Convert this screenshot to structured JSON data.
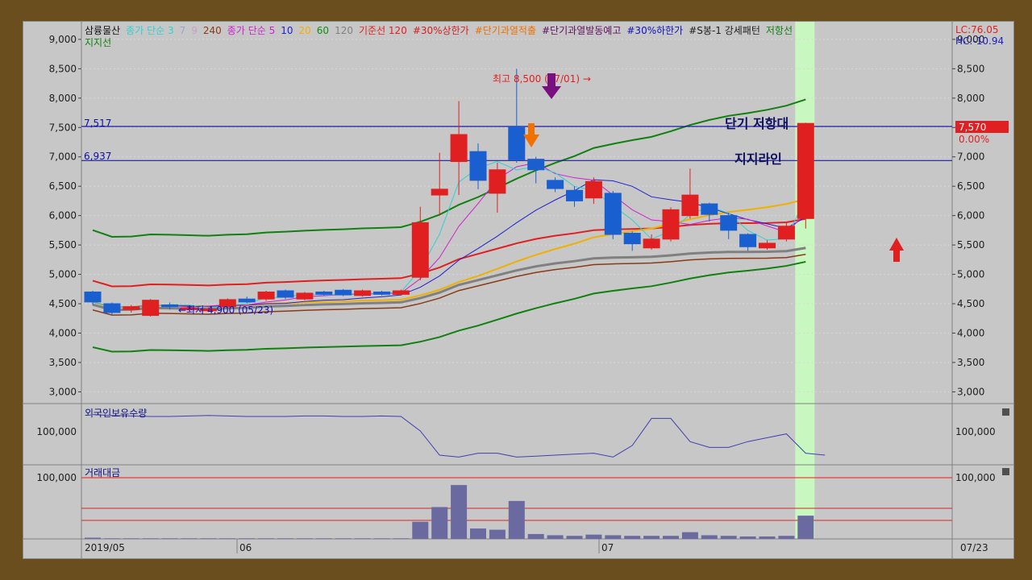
{
  "legend": [
    {
      "text": "삼륭물산",
      "color": "#111111"
    },
    {
      "text": "종가 단순 3",
      "color": "#31d0d0"
    },
    {
      "text": "7",
      "color": "#a0a0d8"
    },
    {
      "text": "9",
      "color": "#c8a0c8"
    },
    {
      "text": "240",
      "color": "#8a3a18"
    },
    {
      "text": "종가 단순 5",
      "color": "#d020d0"
    },
    {
      "text": "10",
      "color": "#2020d0"
    },
    {
      "text": "20",
      "color": "#f0b000"
    },
    {
      "text": "60",
      "color": "#109010"
    },
    {
      "text": "120",
      "color": "#808080"
    },
    {
      "text": "기준선 120",
      "color": "#e02020"
    },
    {
      "text": "#30%상한가",
      "color": "#d02020"
    },
    {
      "text": "#단기과열적출",
      "color": "#f07000"
    },
    {
      "text": "#단기과열발동예고",
      "color": "#601060"
    },
    {
      "text": "#30%하한가",
      "color": "#1010c0"
    },
    {
      "text": "#S봉-1 강세패턴",
      "color": "#202020"
    },
    {
      "text": "저항선",
      "color": "#108010"
    }
  ],
  "legend_line2": "지지선",
  "lc_label": "LC:76.05",
  "hc_label": "HC:-10.94",
  "price_label": "7,570",
  "pct_label": "0.00%",
  "resistance_label": "7,517",
  "support_label": "6,937",
  "high_annotation": "최고 8,500 (07/01) →",
  "low_annotation": "←최저 4,900 (05/23)",
  "resistance_text": "단기 저항대",
  "support_text": "지지라인",
  "foreign_title": "외국인보유수량",
  "volume_title": "거래대금",
  "foreign_tick": "100,000",
  "volume_tick": "100,000",
  "xaxis_labels": [
    "2019/05",
    "06",
    "07",
    "07/23"
  ],
  "chart_data": {
    "type": "candlestick",
    "ylim": [
      2800,
      9300
    ],
    "y_ticks": [
      3000,
      3500,
      4000,
      4500,
      5000,
      5500,
      6000,
      6500,
      7000,
      7500,
      8000,
      8500,
      9000
    ],
    "hlines": [
      7517,
      6937
    ],
    "candles": [
      {
        "o": 4700,
        "c": 4530,
        "h": 4720,
        "l": 4480
      },
      {
        "o": 4500,
        "c": 4350,
        "h": 4520,
        "l": 4300
      },
      {
        "o": 4400,
        "c": 4450,
        "h": 4480,
        "l": 4350
      },
      {
        "o": 4300,
        "c": 4560,
        "h": 4580,
        "l": 4280
      },
      {
        "o": 4480,
        "c": 4450,
        "h": 4520,
        "l": 4400
      },
      {
        "o": 4400,
        "c": 4430,
        "h": 4460,
        "l": 4380
      },
      {
        "o": 4380,
        "c": 4410,
        "h": 4440,
        "l": 4360
      },
      {
        "o": 4450,
        "c": 4570,
        "h": 4590,
        "l": 4430
      },
      {
        "o": 4580,
        "c": 4530,
        "h": 4620,
        "l": 4510
      },
      {
        "o": 4580,
        "c": 4700,
        "h": 4720,
        "l": 4550
      },
      {
        "o": 4720,
        "c": 4610,
        "h": 4740,
        "l": 4580
      },
      {
        "o": 4580,
        "c": 4680,
        "h": 4700,
        "l": 4560
      },
      {
        "o": 4700,
        "c": 4660,
        "h": 4720,
        "l": 4640
      },
      {
        "o": 4730,
        "c": 4650,
        "h": 4750,
        "l": 4630
      },
      {
        "o": 4640,
        "c": 4720,
        "h": 4740,
        "l": 4620
      },
      {
        "o": 4700,
        "c": 4660,
        "h": 4720,
        "l": 4640
      },
      {
        "o": 4660,
        "c": 4720,
        "h": 4740,
        "l": 4640
      },
      {
        "o": 4950,
        "c": 5880,
        "h": 6150,
        "l": 4900
      },
      {
        "o": 6350,
        "c": 6450,
        "h": 7070,
        "l": 6000
      },
      {
        "o": 6920,
        "c": 7380,
        "h": 7950,
        "l": 6350
      },
      {
        "o": 7090,
        "c": 6600,
        "h": 7230,
        "l": 6450
      },
      {
        "o": 6380,
        "c": 6780,
        "h": 6900,
        "l": 6050
      },
      {
        "o": 7510,
        "c": 6950,
        "h": 8500,
        "l": 6900
      },
      {
        "o": 6960,
        "c": 6780,
        "h": 7000,
        "l": 6550
      },
      {
        "o": 6600,
        "c": 6460,
        "h": 6650,
        "l": 6400
      },
      {
        "o": 6430,
        "c": 6250,
        "h": 6500,
        "l": 6150
      },
      {
        "o": 6300,
        "c": 6580,
        "h": 6650,
        "l": 6200
      },
      {
        "o": 6380,
        "c": 5680,
        "h": 6420,
        "l": 5600
      },
      {
        "o": 5700,
        "c": 5520,
        "h": 5730,
        "l": 5400
      },
      {
        "o": 5450,
        "c": 5600,
        "h": 5680,
        "l": 5420
      },
      {
        "o": 5600,
        "c": 6100,
        "h": 6140,
        "l": 5560
      },
      {
        "o": 6000,
        "c": 6350,
        "h": 6800,
        "l": 5950
      },
      {
        "o": 6200,
        "c": 6020,
        "h": 6220,
        "l": 5900
      },
      {
        "o": 6000,
        "c": 5750,
        "h": 6050,
        "l": 5600
      },
      {
        "o": 5680,
        "c": 5470,
        "h": 5700,
        "l": 5400
      },
      {
        "o": 5450,
        "c": 5530,
        "h": 5580,
        "l": 5420
      },
      {
        "o": 5600,
        "c": 5820,
        "h": 5880,
        "l": 5560
      },
      {
        "o": 5950,
        "c": 7570,
        "h": 7580,
        "l": 5780
      }
    ],
    "foreign": [
      112000,
      111000,
      110500,
      110000,
      110000,
      110500,
      111000,
      110500,
      110000,
      110000,
      110000,
      110500,
      110500,
      110000,
      110000,
      110500,
      110000,
      95000,
      70000,
      68000,
      72000,
      72000,
      68000,
      69000,
      70000,
      71000,
      72000,
      68000,
      80000,
      108000,
      108000,
      84000,
      78000,
      78000,
      84000,
      88000,
      92000,
      72000,
      70000
    ],
    "volume": [
      2,
      1,
      1,
      1,
      1,
      1,
      1,
      1,
      1,
      1,
      1,
      1,
      1,
      1,
      1,
      1,
      1,
      28,
      52,
      88,
      17,
      15,
      62,
      8,
      6,
      5,
      7,
      6,
      5,
      5,
      5,
      11,
      6,
      5,
      4,
      4,
      5,
      38
    ]
  }
}
